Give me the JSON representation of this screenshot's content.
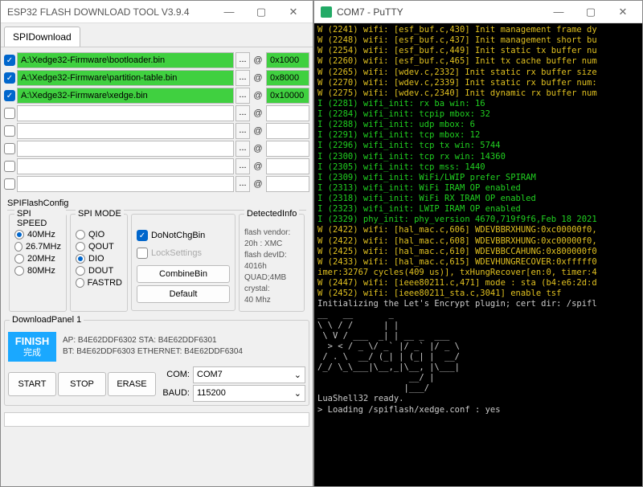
{
  "left_window": {
    "title": "ESP32 FLASH DOWNLOAD TOOL V3.9.4",
    "tab": "SPIDownload",
    "rows": [
      {
        "checked": true,
        "path": "A:\\Xedge32-Firmware\\bootloader.bin",
        "addr": "0x1000"
      },
      {
        "checked": true,
        "path": "A:\\Xedge32-Firmware\\partition-table.bin",
        "addr": "0x8000"
      },
      {
        "checked": true,
        "path": "A:\\Xedge32-Firmware\\xedge.bin",
        "addr": "0x10000"
      },
      {
        "checked": false,
        "path": "",
        "addr": ""
      },
      {
        "checked": false,
        "path": "",
        "addr": ""
      },
      {
        "checked": false,
        "path": "",
        "addr": ""
      },
      {
        "checked": false,
        "path": "",
        "addr": ""
      },
      {
        "checked": false,
        "path": "",
        "addr": ""
      }
    ],
    "config_label": "SPIFlashConfig",
    "speed": {
      "label": "SPI SPEED",
      "options": [
        "40MHz",
        "26.7MHz",
        "20MHz",
        "80MHz"
      ],
      "selected": "40MHz"
    },
    "mode": {
      "label": "SPI MODE",
      "options": [
        "QIO",
        "QOUT",
        "DIO",
        "DOUT",
        "FASTRD"
      ],
      "selected": "DIO"
    },
    "donotchg": {
      "label": "DoNotChgBin",
      "checked": true
    },
    "locksettings": {
      "label": "LockSettings",
      "checked": false
    },
    "combine_btn": "CombineBin",
    "default_btn": "Default",
    "detected": {
      "label": "DetectedInfo",
      "lines": [
        "flash vendor:",
        "20h : XMC",
        "flash devID:",
        "4016h",
        "QUAD;4MB",
        "crystal:",
        "40 Mhz"
      ]
    },
    "panel_label": "DownloadPanel 1",
    "finish": {
      "main": "FINISH",
      "sub": "完成"
    },
    "info": {
      "line1": "AP:  B4E62DDF6302 STA:  B4E62DDF6301",
      "line2": "BT:  B4E62DDF6303 ETHERNET:  B4E62DDF6304"
    },
    "start": "START",
    "stop": "STOP",
    "erase": "ERASE",
    "com_label": "COM:",
    "com_value": "COM7",
    "baud_label": "BAUD:",
    "baud_value": "115200"
  },
  "right_window": {
    "title": "COM7 - PuTTY",
    "lines": [
      {
        "c": "y",
        "t": "W (2241) wifi: [esf_buf.c,430] Init management frame dy"
      },
      {
        "c": "y",
        "t": "W (2248) wifi: [esf_buf.c,437] Init management short bu"
      },
      {
        "c": "y",
        "t": "W (2254) wifi: [esf_buf.c,449] Init static tx buffer nu"
      },
      {
        "c": "y",
        "t": "W (2260) wifi: [esf_buf.c,465] Init tx cache buffer num"
      },
      {
        "c": "y",
        "t": "W (2265) wifi: [wdev.c,2332] Init static rx buffer size"
      },
      {
        "c": "y",
        "t": "W (2270) wifi: [wdev.c,2339] Init static rx buffer num:"
      },
      {
        "c": "y",
        "t": "W (2275) wifi: [wdev.c,2340] Init dynamic rx buffer num"
      },
      {
        "c": "g",
        "t": "I (2281) wifi_init: rx ba win: 16"
      },
      {
        "c": "g",
        "t": "I (2284) wifi_init: tcpip mbox: 32"
      },
      {
        "c": "g",
        "t": "I (2288) wifi_init: udp mbox: 6"
      },
      {
        "c": "g",
        "t": "I (2291) wifi_init: tcp mbox: 12"
      },
      {
        "c": "g",
        "t": "I (2296) wifi_init: tcp tx win: 5744"
      },
      {
        "c": "g",
        "t": "I (2300) wifi_init: tcp rx win: 14360"
      },
      {
        "c": "g",
        "t": "I (2305) wifi_init: tcp mss: 1440"
      },
      {
        "c": "g",
        "t": "I (2309) wifi_init: WiFi/LWIP prefer SPIRAM"
      },
      {
        "c": "g",
        "t": "I (2313) wifi_init: WiFi IRAM OP enabled"
      },
      {
        "c": "g",
        "t": "I (2318) wifi_init: WiFi RX IRAM OP enabled"
      },
      {
        "c": "g",
        "t": "I (2323) wifi_init: LWIP IRAM OP enabled"
      },
      {
        "c": "g",
        "t": "I (2329) phy_init: phy_version 4670,719f9f6,Feb 18 2021"
      },
      {
        "c": "y",
        "t": "W (2422) wifi: [hal_mac.c,606] WDEVBBRXHUNG:0xc00000f0,"
      },
      {
        "c": "y",
        "t": "W (2422) wifi: [hal_mac.c,608] WDEVBBRXHUNG:0xc00000f0,"
      },
      {
        "c": "y",
        "t": "W (2425) wifi: [hal_mac.c,610] WDEVBBCCAHUNG:0x800000f0"
      },
      {
        "c": "y",
        "t": ""
      },
      {
        "c": "y",
        "t": "W (2433) wifi: [hal_mac.c,615] WDEVHUNGRECOVER:0xfffff0"
      },
      {
        "c": "y",
        "t": "imer:32767 cycles(409 us)], txHungRecover[en:0, timer:4"
      },
      {
        "c": "y",
        "t": "W (2447) wifi: [ieee80211.c,471] mode : sta (b4:e6:2d:d"
      },
      {
        "c": "y",
        "t": "W (2452) wifi: [ieee80211_sta.c,3041] enable tsf"
      },
      {
        "c": "w",
        "t": "Initializing the Let's Encrypt plugin; cert dir: /spifl"
      },
      {
        "c": "w",
        "t": ""
      },
      {
        "c": "w",
        "t": ""
      },
      {
        "c": "w",
        "t": "__   __       _"
      },
      {
        "c": "w",
        "t": "\\ \\ / /      | |"
      },
      {
        "c": "w",
        "t": " \\ V / ___  _| | __ _  ___"
      },
      {
        "c": "w",
        "t": "  > < / _ \\/ _` |/ _` |/ _ \\"
      },
      {
        "c": "w",
        "t": " / . \\  __/ (_| | (_| |  __/"
      },
      {
        "c": "w",
        "t": "/_/ \\_\\___|\\__,_|\\__, |\\___|"
      },
      {
        "c": "w",
        "t": "                  __/ |"
      },
      {
        "c": "w",
        "t": "                 |___/"
      },
      {
        "c": "w",
        "t": ""
      },
      {
        "c": "w",
        "t": "LuaShell32 ready."
      },
      {
        "c": "w",
        "t": "> Loading /spiflash/xedge.conf : yes"
      }
    ]
  }
}
